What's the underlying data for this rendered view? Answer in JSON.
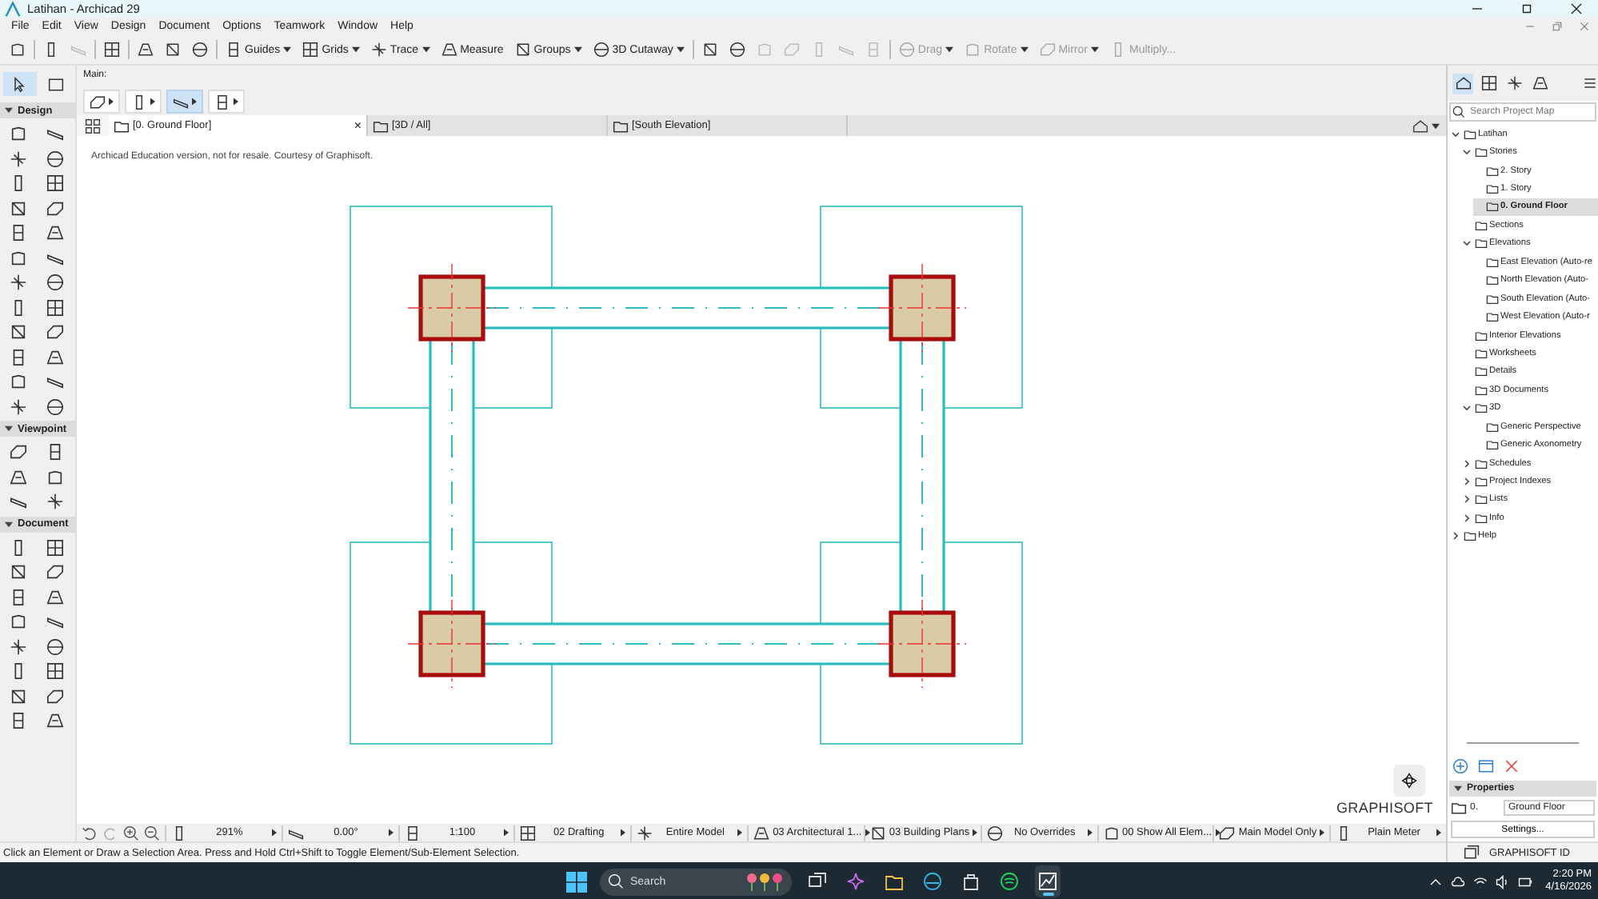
{
  "window": {
    "title": "Latihan - Archicad 29"
  },
  "menu": [
    "File",
    "Edit",
    "View",
    "Design",
    "Document",
    "Options",
    "Teamwork",
    "Window",
    "Help"
  ],
  "toolbar": [
    {
      "kind": "icon",
      "disabled": false
    },
    {
      "kind": "separator"
    },
    {
      "kind": "icon",
      "disabled": false
    },
    {
      "kind": "icon",
      "disabled": true
    },
    {
      "kind": "separator"
    },
    {
      "kind": "icon",
      "disabled": false
    },
    {
      "kind": "separator"
    },
    {
      "kind": "icon",
      "disabled": false
    },
    {
      "kind": "icon",
      "disabled": false
    },
    {
      "kind": "icon",
      "disabled": false
    },
    {
      "kind": "separator"
    },
    {
      "kind": "dropdown",
      "label": "Guides",
      "disabled": false
    },
    {
      "kind": "dropdown",
      "label": "Grids",
      "disabled": false
    },
    {
      "kind": "dropdown",
      "label": "Trace",
      "disabled": false
    },
    {
      "kind": "button",
      "label": "Measure",
      "disabled": false
    },
    {
      "kind": "dropdown",
      "label": "Groups",
      "disabled": false
    },
    {
      "kind": "dropdown",
      "label": "3D Cutaway",
      "disabled": false
    },
    {
      "kind": "separator"
    },
    {
      "kind": "icon",
      "disabled": false
    },
    {
      "kind": "icon",
      "disabled": false
    },
    {
      "kind": "icon",
      "disabled": true
    },
    {
      "kind": "icon",
      "disabled": true
    },
    {
      "kind": "icon",
      "disabled": true
    },
    {
      "kind": "icon",
      "disabled": true
    },
    {
      "kind": "icon",
      "disabled": true
    },
    {
      "kind": "separator"
    },
    {
      "kind": "dropdown",
      "label": "Drag",
      "disabled": true
    },
    {
      "kind": "dropdown",
      "label": "Rotate",
      "disabled": true
    },
    {
      "kind": "dropdown",
      "label": "Mirror",
      "disabled": true
    },
    {
      "kind": "button",
      "label": "Multiply...",
      "disabled": true
    }
  ],
  "toolbox": {
    "pointer_tools": [
      {
        "selected": true
      },
      {
        "selected": false
      }
    ],
    "sections": [
      {
        "title": "Design",
        "expanded": true
      },
      {
        "title": "Viewpoint",
        "expanded": true
      },
      {
        "title": "Document",
        "expanded": true
      }
    ]
  },
  "info_box": {
    "label": "Main:",
    "buttons": [
      {
        "on": false
      },
      {
        "on": false
      },
      {
        "on": true
      },
      {
        "on": false
      }
    ]
  },
  "tabs": [
    {
      "label": "[0. Ground Floor]",
      "selected": true,
      "close": "×"
    },
    {
      "label": "[3D / All]",
      "selected": false
    },
    {
      "label": "[South Elevation]",
      "selected": false
    }
  ],
  "canvas": {
    "note": "Archicad Education version, not for resale. Courtesy of Graphisoft.",
    "logo": "GRAPHISOFT"
  },
  "navigator": {
    "views": [
      {
        "selected": true
      },
      {
        "selected": false
      },
      {
        "selected": false
      },
      {
        "selected": false
      }
    ],
    "search": {
      "placeholder": "Search Project Map"
    },
    "tree": [
      {
        "label": "Latihan",
        "expanded": true,
        "selected": false,
        "children": [
          {
            "label": "Stories",
            "expanded": true,
            "selected": false,
            "children": [
              {
                "label": "2. Story",
                "selected": false
              },
              {
                "label": "1. Story",
                "selected": false
              },
              {
                "label": "0. Ground Floor",
                "selected": true
              }
            ]
          },
          {
            "label": "Sections",
            "selected": false
          },
          {
            "label": "Elevations",
            "expanded": true,
            "selected": false,
            "children": [
              {
                "label": "East Elevation (Auto-re",
                "selected": false
              },
              {
                "label": "North Elevation (Auto-",
                "selected": false
              },
              {
                "label": "South Elevation (Auto-",
                "selected": false
              },
              {
                "label": "West Elevation (Auto-r",
                "selected": false
              }
            ]
          },
          {
            "label": "Interior Elevations",
            "selected": false
          },
          {
            "label": "Worksheets",
            "selected": false
          },
          {
            "label": "Details",
            "selected": false
          },
          {
            "label": "3D Documents",
            "selected": false
          },
          {
            "label": "3D",
            "expanded": true,
            "selected": false,
            "children": [
              {
                "label": "Generic Perspective",
                "selected": false
              },
              {
                "label": "Generic Axonometry",
                "selected": false
              }
            ]
          },
          {
            "label": "Schedules",
            "expanded": false,
            "selected": false
          },
          {
            "label": "Project Indexes",
            "expanded": false,
            "selected": false
          },
          {
            "label": "Lists",
            "expanded": false,
            "selected": false
          },
          {
            "label": "Info",
            "expanded": false,
            "selected": false
          }
        ]
      },
      {
        "label": "Help",
        "expanded": false,
        "selected": false
      }
    ]
  },
  "properties": {
    "title": "Properties",
    "expanded": true,
    "story_index": "0.",
    "story_name": "Ground Floor",
    "settings": "Settings..."
  },
  "account": "GRAPHISOFT ID",
  "quick_options": [
    "291%",
    "0.00°",
    "1:100",
    "02 Drafting",
    "Entire Model",
    "03 Architectural 1...",
    "03 Building Plans",
    "No Overrides",
    "00 Show All Elem...",
    "Main Model Only",
    "Plain Meter"
  ],
  "status": "Click an Element or Draw a Selection Area. Press and Hold Ctrl+Shift to Toggle Element/Sub-Element Selection.",
  "taskbar": {
    "search": "Search",
    "apps": [
      {
        "selected": false
      },
      {
        "selected": false
      },
      {
        "selected": false
      },
      {
        "selected": false
      },
      {
        "selected": false
      },
      {
        "selected": false
      },
      {
        "selected": true
      }
    ],
    "time": "2:20 PM",
    "date": "4/16/2026"
  }
}
